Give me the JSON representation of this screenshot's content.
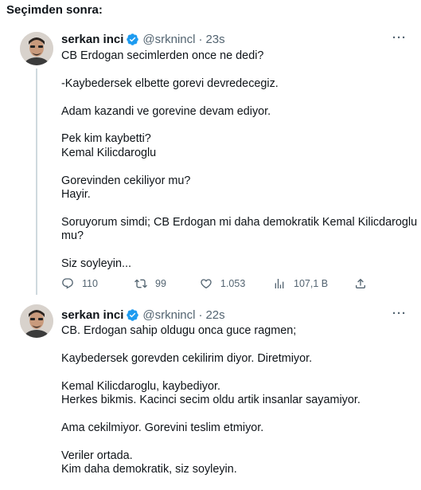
{
  "heading": "Seçimden sonra:",
  "tweets": [
    {
      "name": "serkan inci",
      "handle": "@srknincl",
      "time": "23s",
      "more": "···",
      "lines": [
        "CB Erdogan secimlerden once ne dedi?",
        "",
        "-Kaybedersek elbette gorevi devredecegiz.",
        "",
        "Adam kazandi ve gorevine devam ediyor.",
        "",
        "Pek kim kaybetti?",
        "Kemal Kilicdaroglu",
        "",
        "Gorevinden cekiliyor mu?",
        "Hayir.",
        "",
        "Soruyorum simdi; CB Erdogan mi daha demokratik Kemal Kilicdaroglu",
        "mu?",
        "",
        "Siz soyleyin..."
      ],
      "actions": {
        "replies": "110",
        "retweets": "99",
        "likes": "1.053",
        "views": "107,1 B"
      }
    },
    {
      "name": "serkan inci",
      "handle": "@srknincl",
      "time": "22s",
      "more": "···",
      "lines": [
        "CB. Erdogan sahip oldugu onca guce ragmen;",
        "",
        "Kaybedersek gorevden cekilirim diyor. Diretmiyor.",
        "",
        "Kemal Kilicdaroglu, kaybediyor.",
        "Herkes bikmis. Kacinci secim oldu artik insanlar sayamiyor.",
        "",
        "Ama cekilmiyor. Gorevini teslim etmiyor.",
        "",
        "Veriler ortada.",
        "Kim daha demokratik, siz soyleyin."
      ]
    }
  ],
  "colors": {
    "text": "#0f1419",
    "secondary": "#536471",
    "verified": "#1d9bf0",
    "thread_line": "#cfd9de"
  },
  "icons": [
    "verified-badge-icon",
    "more-icon",
    "reply-icon",
    "retweet-icon",
    "like-icon",
    "views-icon",
    "share-icon"
  ]
}
